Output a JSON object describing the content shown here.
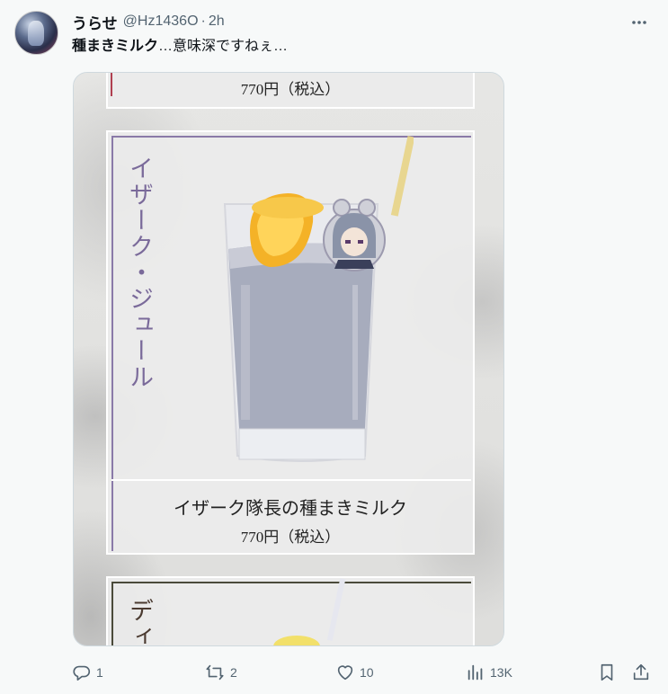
{
  "post": {
    "display_name": "うらせ",
    "handle": "@Hz1436O",
    "separator": "·",
    "time": "2h",
    "text_bold": "種まきミルク",
    "text_rest": "…意味深ですねぇ…"
  },
  "media": {
    "top_price": "770円（税込）",
    "vertical_title": "イザーク・ジュール",
    "item_name": "イザーク隊長の種まきミルク",
    "item_price": "770円（税込）",
    "next_vertical_title": "ディ"
  },
  "actions": {
    "reply_count": "1",
    "repost_count": "2",
    "like_count": "10",
    "views_count": "13K"
  },
  "colors": {
    "accent_frame": "#8a7aa8",
    "title_purple": "#7a6a9a",
    "secondary_text": "#536471"
  }
}
